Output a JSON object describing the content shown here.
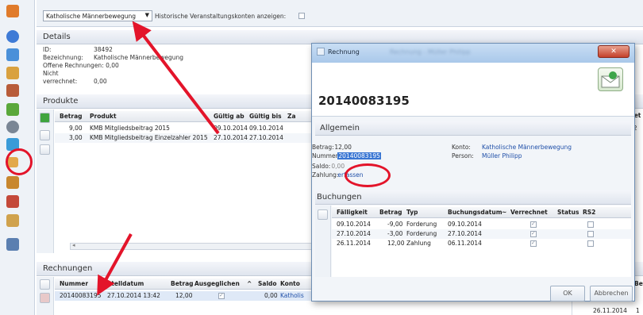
{
  "topbar": {
    "account_select": "Katholische Männerbewegung",
    "historic_label": "Historische Veranstaltungskonten anzeigen:"
  },
  "details": {
    "title": "Details",
    "id_label": "ID:",
    "id_value": "38492",
    "name_label": "Bezeichnung:",
    "name_value": "Katholische Männerbewegung",
    "open_label": "Offene Rechnungen:",
    "open_value": "0,00",
    "unsettled_label": "Nicht verrechnet:",
    "unsettled_value": "0,00"
  },
  "products": {
    "title": "Produkte",
    "columns": [
      "Betrag",
      "Produkt",
      "Gültig ab",
      "Gültig bis",
      "Za"
    ],
    "rows": [
      [
        "9,00",
        "KMB Mitgliedsbeitrag 2015",
        "09.10.2014",
        "09.10.2014"
      ],
      [
        "3,00",
        "KMB Mitgliedsbeitrag Einzelzahler 2015",
        "27.10.2014",
        "27.10.2014"
      ]
    ]
  },
  "invoices": {
    "title": "Rechnungen",
    "columns": [
      "Nummer",
      "Erstelldatum",
      "Betrag",
      "Ausgeglichen",
      "Saldo",
      "Konto"
    ],
    "row": [
      "20140083195",
      "27.10.2014 13:42",
      "12,00",
      "",
      "0,00",
      "Katholis"
    ]
  },
  "right_strip": {
    "col_top": "Bet",
    "val_top": "12",
    "col_bottom": "Bet",
    "date_bottom": "26.11.2014",
    "val_bottom": "1"
  },
  "dialog": {
    "window_title": "Rechnung",
    "blurred_title": "Rechnung - Müller Philipp",
    "close_glyph": "✕",
    "number_heading": "20140083195",
    "section_general": "Allgemein",
    "amount_label": "Betrag:",
    "amount_value": "12,00",
    "number_label": "Nummer:",
    "number_value": "20140083195",
    "balance_label": "Saldo:",
    "balance_value": "0,00",
    "payment_label": "Zahlung:",
    "payment_link": "erfassen",
    "account_label": "Konto:",
    "account_value": "Katholische Männerbewegung",
    "person_label": "Person:",
    "person_value": "Müller Philipp",
    "section_bookings": "Buchungen",
    "booking_columns": [
      "Fälligkeit",
      "Betrag",
      "Typ",
      "Buchungsdatum",
      "Verrechnet",
      "Status",
      "RS2"
    ],
    "bookings": [
      [
        "09.10.2014",
        "-9,00",
        "Forderung",
        "09.10.2014"
      ],
      [
        "27.10.2014",
        "-3,00",
        "Forderung",
        "27.10.2014"
      ],
      [
        "26.11.2014",
        "12,00",
        "Zahlung",
        "06.11.2014"
      ]
    ],
    "ok_label": "OK",
    "cancel_label": "Abbrechen"
  },
  "colors": {
    "annotation_red": "#e3142a",
    "link_blue": "#1f4fa8",
    "header_gradient_top": "#f4f6fa",
    "dialog_titlebar": "#a9c8ea"
  }
}
